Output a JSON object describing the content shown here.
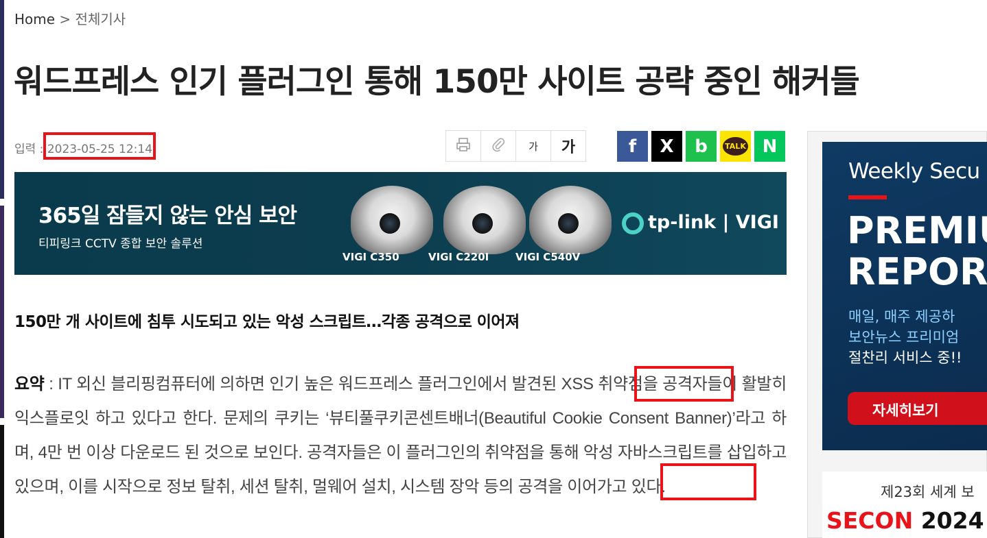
{
  "breadcrumb": {
    "home": "Home",
    "separator": ">",
    "current": "전체기사"
  },
  "headline": "워드프레스 인기 플러그인 통해 150만 사이트 공략 중인 해커들",
  "meta": {
    "label": "입력 :",
    "date": "2023-05-25 12:14"
  },
  "tools": {
    "font_small": "가",
    "font_large": "가"
  },
  "share": {
    "facebook": "f",
    "x": "X",
    "band": "b",
    "kakaotalk": "TALK",
    "naver": "N"
  },
  "banner": {
    "title": "365일 잠들지 않는 안심 보안",
    "subtitle": "티피링크 CCTV 종합 보안 솔루션",
    "cameras": [
      "VIGI C350",
      "VIGI C220I",
      "VIGI C540V"
    ],
    "brand": "tp-link | VIGI"
  },
  "article": {
    "subtitle": "150만 개 사이트에 침투 시도되고 있는 악성 스크립트…각종 공격으로 이어져",
    "summary_label": "요약",
    "summary_sep": " : ",
    "summary_body": "IT 외신 블리핑컴퓨터에 의하면 인기 높은 워드프레스 플러그인에서 발견된 XSS 취약점을 공격자들이 활발히 익스플로잇 하고 있다고 한다. 문제의 쿠키는 ‘뷰티풀쿠키콘센트배너(Beautiful Cookie Consent Banner)’라고 하며, 4만 번 이상 다운로드 된 것으로 보인다. 공격자들은 이 플러그인의 취약점을 통해 악성 자바스크립트를 삽입하고 있으며, 이를 시작으로 정보 탈취, 세션 탈취, 멀웨어 설치, 시스템 장악 등의 공격을 이어가고 있다."
  },
  "sidebar": {
    "ad1": {
      "weekly": "Weekly Secu",
      "premium": "PREMIU",
      "report": "REPOR",
      "desc1": "매일, 매주 제공하",
      "desc2": "보안뉴스 프리미엄",
      "desc3": "절찬리 서비스 중!!",
      "button": "자세히보기"
    },
    "ad2": {
      "title": "제23회 세계 보",
      "secon": "SECON",
      "year": "2024"
    }
  },
  "colors": {
    "highlight": "#e8141a",
    "banner_bg": "#0a3b4c",
    "ad_bg": "#0f3a63"
  }
}
